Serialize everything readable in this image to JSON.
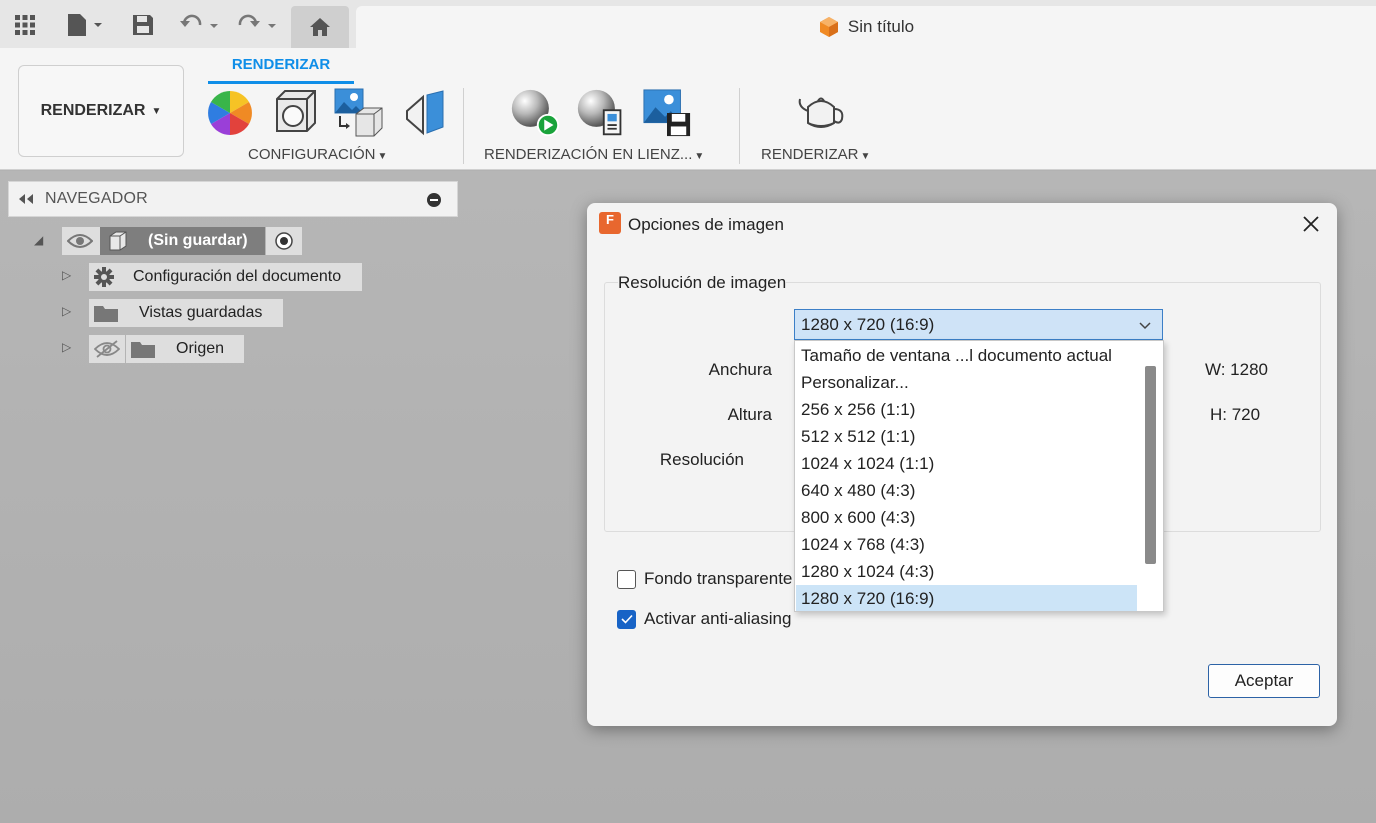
{
  "window": {
    "doc_title": "Sin título"
  },
  "ribbon": {
    "workspace_label": "RENDERIZAR",
    "active_tab": "RENDERIZAR",
    "groups": [
      {
        "label": "CONFIGURACIÓN"
      },
      {
        "label": "RENDERIZACIÓN EN LIENZ..."
      },
      {
        "label": "RENDERIZAR"
      }
    ]
  },
  "browser": {
    "title": "NAVEGADOR",
    "root": "(Sin guardar)",
    "items": [
      {
        "label": "Configuración del documento"
      },
      {
        "label": "Vistas guardadas"
      },
      {
        "label": "Origen"
      }
    ]
  },
  "dialog": {
    "title": "Opciones de imagen",
    "group_label": "Resolución de imagen",
    "selected_resolution": "1280 x 720 (16:9)",
    "width_label": "Anchura",
    "height_label": "Altura",
    "resolution_label": "Resolución",
    "width_value": "W: 1280",
    "height_value": "H: 720",
    "transparent_bg_label": "Fondo transparente",
    "transparent_bg_checked": false,
    "antialias_label": "Activar anti-aliasing",
    "antialias_checked": true,
    "accept_label": "Aceptar",
    "app_icon_letter": "F"
  },
  "dropdown": {
    "options": [
      "Tamaño de ventana ...l documento actual",
      "Personalizar...",
      "256 x 256 (1:1)",
      "512 x 512 (1:1)",
      "1024 x 1024 (1:1)",
      "640 x 480 (4:3)",
      "800 x 600 (4:3)",
      "1024 x 768 (4:3)",
      "1280 x 1024 (4:3)",
      "1280 x 720 (16:9)"
    ],
    "selected_index": 9
  },
  "colors": {
    "accent": "#0f8ee8",
    "checkbox": "#1763c6",
    "selection": "#cce4f7"
  }
}
